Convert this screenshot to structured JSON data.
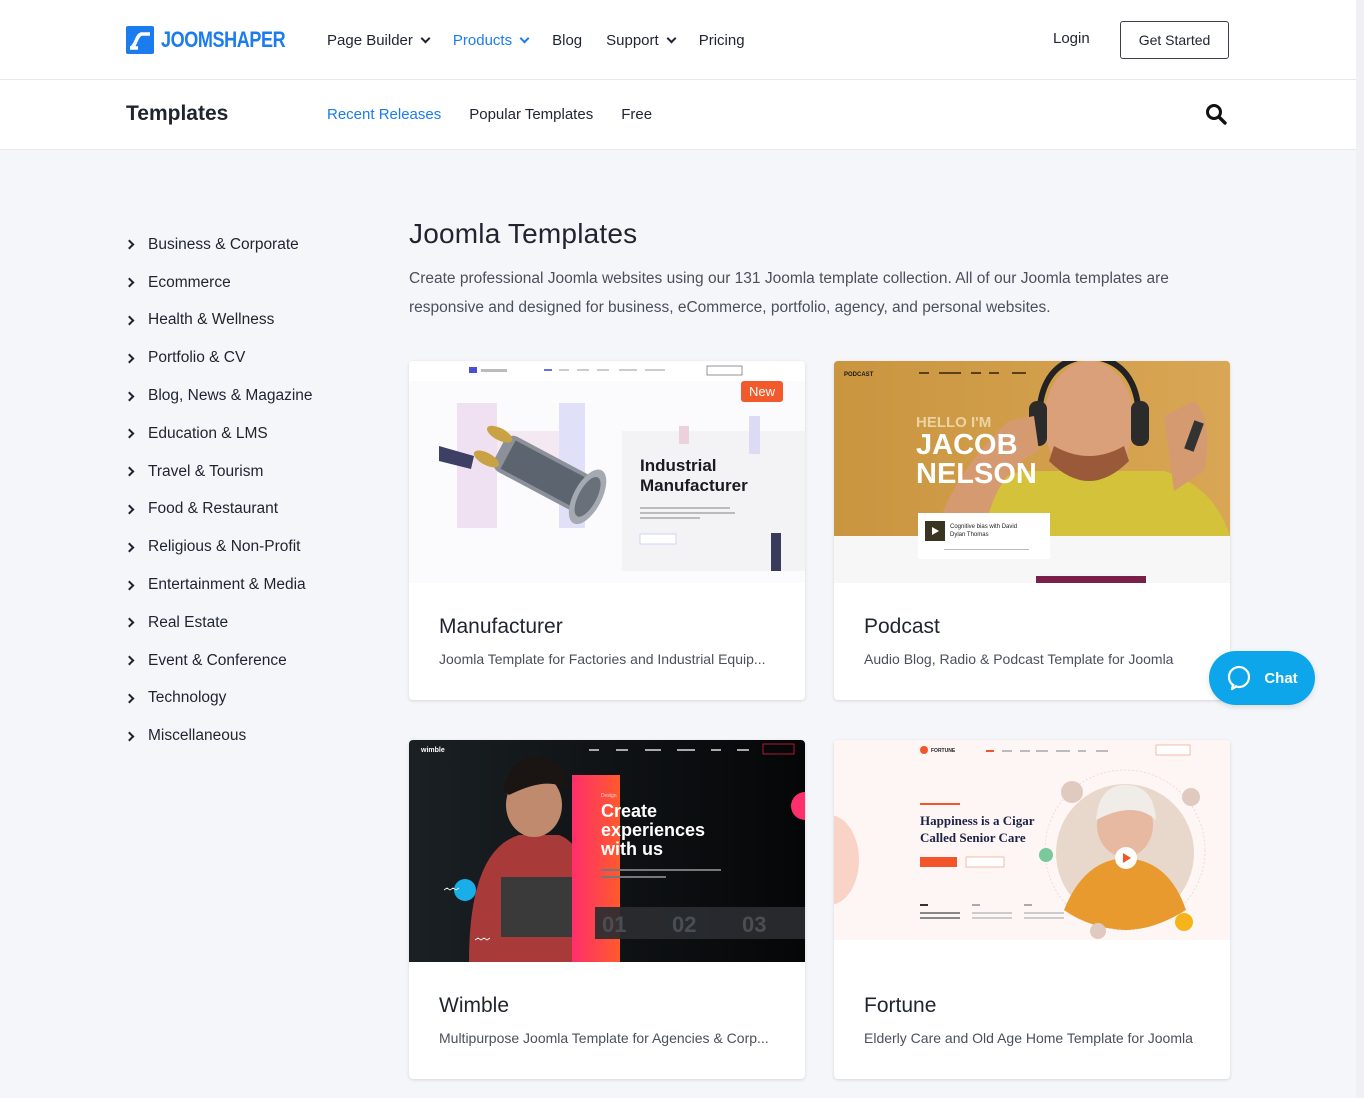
{
  "header": {
    "brand": "JOOMSHAPER",
    "nav": [
      {
        "label": "Page Builder",
        "dropdown": true,
        "active": false
      },
      {
        "label": "Products",
        "dropdown": true,
        "active": true
      },
      {
        "label": "Blog",
        "dropdown": false,
        "active": false
      },
      {
        "label": "Support",
        "dropdown": true,
        "active": false
      },
      {
        "label": "Pricing",
        "dropdown": false,
        "active": false
      }
    ],
    "login_label": "Login",
    "cta_label": "Get Started"
  },
  "subheader": {
    "title": "Templates",
    "tabs": [
      {
        "label": "Recent Releases",
        "active": true
      },
      {
        "label": "Popular Templates",
        "active": false
      },
      {
        "label": "Free",
        "active": false
      }
    ],
    "search_icon": "search-icon"
  },
  "sidebar": {
    "categories": [
      "Business & Corporate",
      "Ecommerce",
      "Health & Wellness",
      "Portfolio & CV",
      "Blog, News & Magazine",
      "Education & LMS",
      "Travel & Tourism",
      "Food & Restaurant",
      "Religious & Non-Profit",
      "Entertainment & Media",
      "Real Estate",
      "Event & Conference",
      "Technology",
      "Miscellaneous"
    ]
  },
  "main": {
    "title": "Joomla Templates",
    "description": "Create professional Joomla websites using our 131 Joomla template collection. All of our Joomla templates are responsive and designed for business, eCommerce, portfolio, agency, and personal websites.",
    "templates": [
      {
        "name": "Manufacturer",
        "desc": "Joomla Template for Factories and Industrial Equip...",
        "badge": "New",
        "preview": {
          "headline_1": "Industrial",
          "headline_2": "Manufacturer"
        }
      },
      {
        "name": "Podcast",
        "desc": "Audio Blog, Radio & Podcast Template for Joomla",
        "preview": {
          "brand": "PODCAST",
          "hello": "HELLO I'M",
          "name_1": "JACOB",
          "name_2": "NELSON",
          "episode": "Cognitive bias with David Dylan Thomas"
        }
      },
      {
        "name": "Wimble",
        "desc": "Multipurpose Joomla Template for Agencies & Corp...",
        "preview": {
          "brand": "wimble",
          "tag": "Design",
          "line_1": "Create",
          "line_2": "experiences",
          "line_3": "with us",
          "steps": [
            "01",
            "02",
            "03"
          ]
        }
      },
      {
        "name": "Fortune",
        "desc": "Elderly Care and Old Age Home Template for Joomla",
        "preview": {
          "brand": "FORTUNE",
          "line_1": "Happiness is a Cigar",
          "line_2": "Called Senior Care"
        }
      }
    ]
  },
  "chat": {
    "label": "Chat"
  },
  "colors": {
    "accent": "#1b7cf0",
    "badge_new": "#f25a2b",
    "chat": "#0da6ea",
    "page_bg": "#f5f6f9"
  }
}
